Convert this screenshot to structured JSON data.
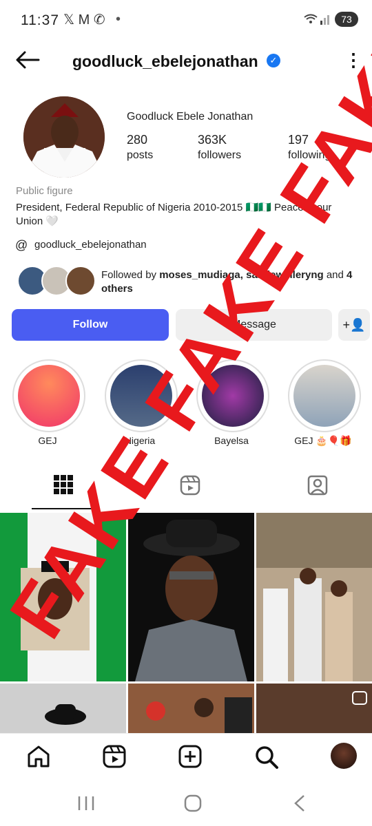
{
  "status": {
    "time": "11:37",
    "icons": "𝕏 M ✆",
    "battery": "73"
  },
  "header": {
    "username": "goodluck_ebelejonathan"
  },
  "profile": {
    "full_name": "Goodluck Ebele Jonathan",
    "posts_count": "280",
    "posts_label": "posts",
    "followers_count": "363K",
    "followers_label": "followers",
    "following_count": "197",
    "following_label": "following",
    "category": "Public figure",
    "bio": "President, Federal Republic of Nigeria 2010-2015 🇳🇬🇳🇬 Peace is our Union 🤍",
    "threads_handle": "goodluck_ebelejonathan",
    "followed_by_prefix": "Followed by ",
    "followed_by_names": "moses_mudiaga, sarajewelleryng",
    "followed_by_suffix": " and ",
    "followed_by_others": "4 others"
  },
  "buttons": {
    "follow": "Follow",
    "message": "Message",
    "add_user": "+👤"
  },
  "highlights": [
    {
      "label": "GEJ"
    },
    {
      "label": "Nigeria"
    },
    {
      "label": "Bayelsa"
    },
    {
      "label": "GEJ 🎂🎈🎁"
    }
  ],
  "watermark": "FAKE FAKE FAKE",
  "colors": {
    "accent": "#4a5df2",
    "verified": "#1877f2",
    "stamp": "#e8191d"
  },
  "icons": {
    "back": "arrow-left-icon",
    "more": "kebab-icon",
    "threads": "threads-icon",
    "grid": "grid-icon",
    "reels": "reels-icon",
    "tagged": "tagged-icon",
    "home": "home-icon",
    "create": "plus-square-icon",
    "search": "search-icon"
  }
}
